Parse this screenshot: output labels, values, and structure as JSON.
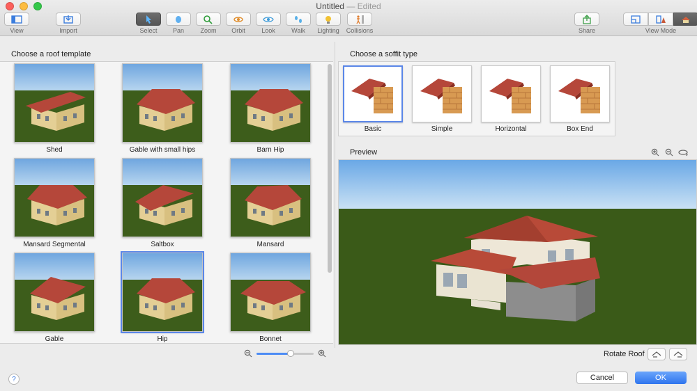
{
  "window": {
    "title": "Untitled",
    "status": "— Edited"
  },
  "toolbar": {
    "view": "View",
    "import": "Import",
    "select": "Select",
    "pan": "Pan",
    "zoom": "Zoom",
    "orbit": "Orbit",
    "look": "Look",
    "walk": "Walk",
    "lighting": "Lighting",
    "collisions": "Collisions",
    "share": "Share",
    "view_mode": "View Mode"
  },
  "templates": {
    "heading": "Choose a roof template",
    "items": [
      "Shed",
      "Gable with small hips",
      "Barn Hip",
      "Mansard Segmental",
      "Saltbox",
      "Mansard",
      "Gable",
      "Hip",
      "Bonnet"
    ],
    "selected": "Hip"
  },
  "soffit": {
    "heading": "Choose a soffit type",
    "items": [
      "Basic",
      "Simple",
      "Horizontal",
      "Box End"
    ],
    "selected": "Basic"
  },
  "preview": {
    "heading": "Preview"
  },
  "footer": {
    "rotate_label": "Rotate Roof",
    "cancel": "Cancel",
    "ok": "OK",
    "help": "?"
  },
  "zoom_slider": {
    "value": 0.6
  },
  "colors": {
    "accent": "#5a86e8",
    "roof": "#b5473a",
    "wall": "#e4cf95",
    "grass": "#3d5d1b",
    "sky": "#7aaee3"
  }
}
